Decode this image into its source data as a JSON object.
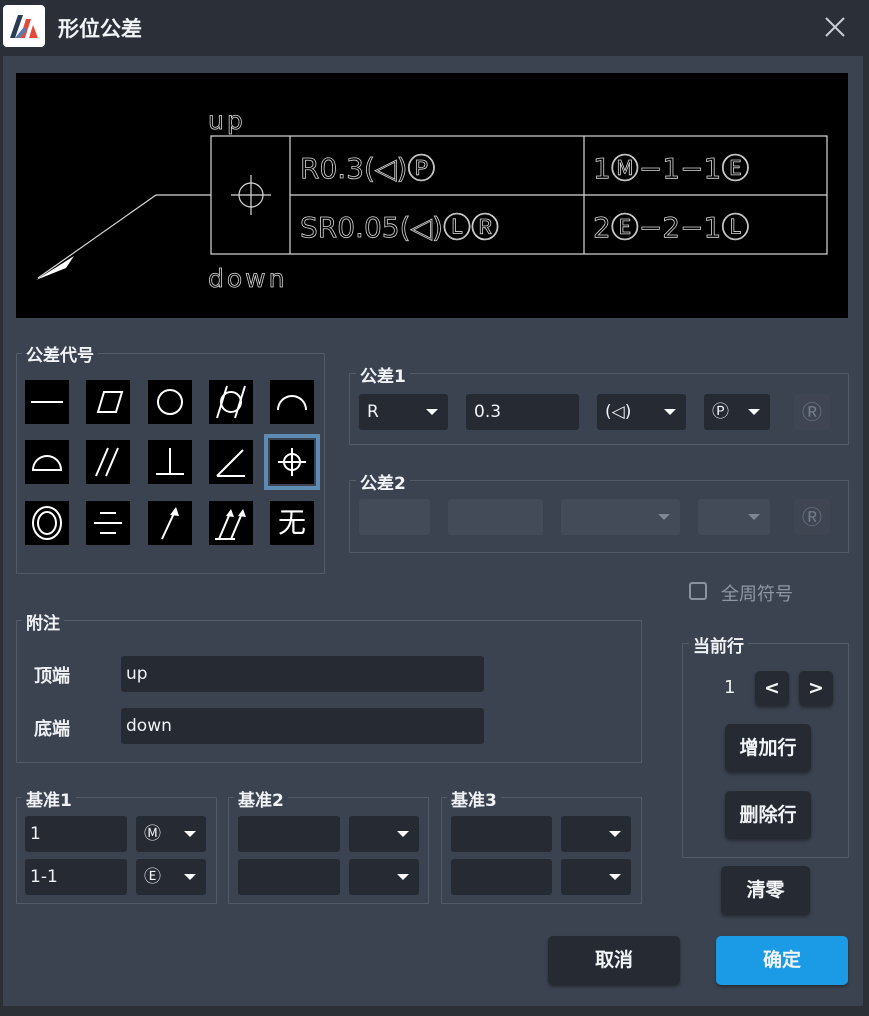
{
  "window": {
    "title": "形位公差"
  },
  "preview": {
    "top_note": "up",
    "bottom_note": "down",
    "row1_tolerance": "R0.3(◁)Ⓟ",
    "row1_datum": "1Ⓜ−1−1Ⓔ",
    "row2_tolerance": "SR0.05(◁)ⓁⓇ",
    "row2_datum": "2Ⓔ−2−1Ⓛ"
  },
  "symbols": {
    "group_label": "公差代号",
    "items": [
      "straightness-icon",
      "flatness-icon",
      "circularity-icon",
      "cylindricity-icon",
      "line-profile-icon",
      "surface-profile-icon",
      "parallelism-icon",
      "perpendicularity-icon",
      "angularity-icon",
      "position-icon",
      "concentricity-icon",
      "symmetry-icon",
      "circular-runout-icon",
      "total-runout-icon",
      "none-icon"
    ],
    "none_label": "无",
    "selected": "position-icon"
  },
  "tolerance1": {
    "label": "公差1",
    "prefix": "R",
    "value": "0.3",
    "modifier": "(◁)",
    "material": "Ⓟ",
    "extra": "Ⓡ"
  },
  "tolerance2": {
    "label": "公差2",
    "extra": "Ⓡ"
  },
  "all_around": {
    "label": "全周符号",
    "checked": false
  },
  "notes": {
    "label": "附注",
    "top_label": "顶端",
    "top_value": "up",
    "bottom_label": "底端",
    "bottom_value": "down"
  },
  "datum1": {
    "label": "基准1",
    "row1_value": "1",
    "row1_mod": "Ⓜ",
    "row2_value": "1-1",
    "row2_mod": "Ⓔ"
  },
  "datum2": {
    "label": "基准2"
  },
  "datum3": {
    "label": "基准3"
  },
  "current_row": {
    "label": "当前行",
    "value": "1",
    "prev": "<",
    "next": ">",
    "add": "增加行",
    "delete": "删除行"
  },
  "actions": {
    "clear": "清零",
    "cancel": "取消",
    "ok": "确定"
  },
  "colors": {
    "accent": "#1b9ae6",
    "panel": "#3b4350",
    "preview_bg": "#000000"
  }
}
